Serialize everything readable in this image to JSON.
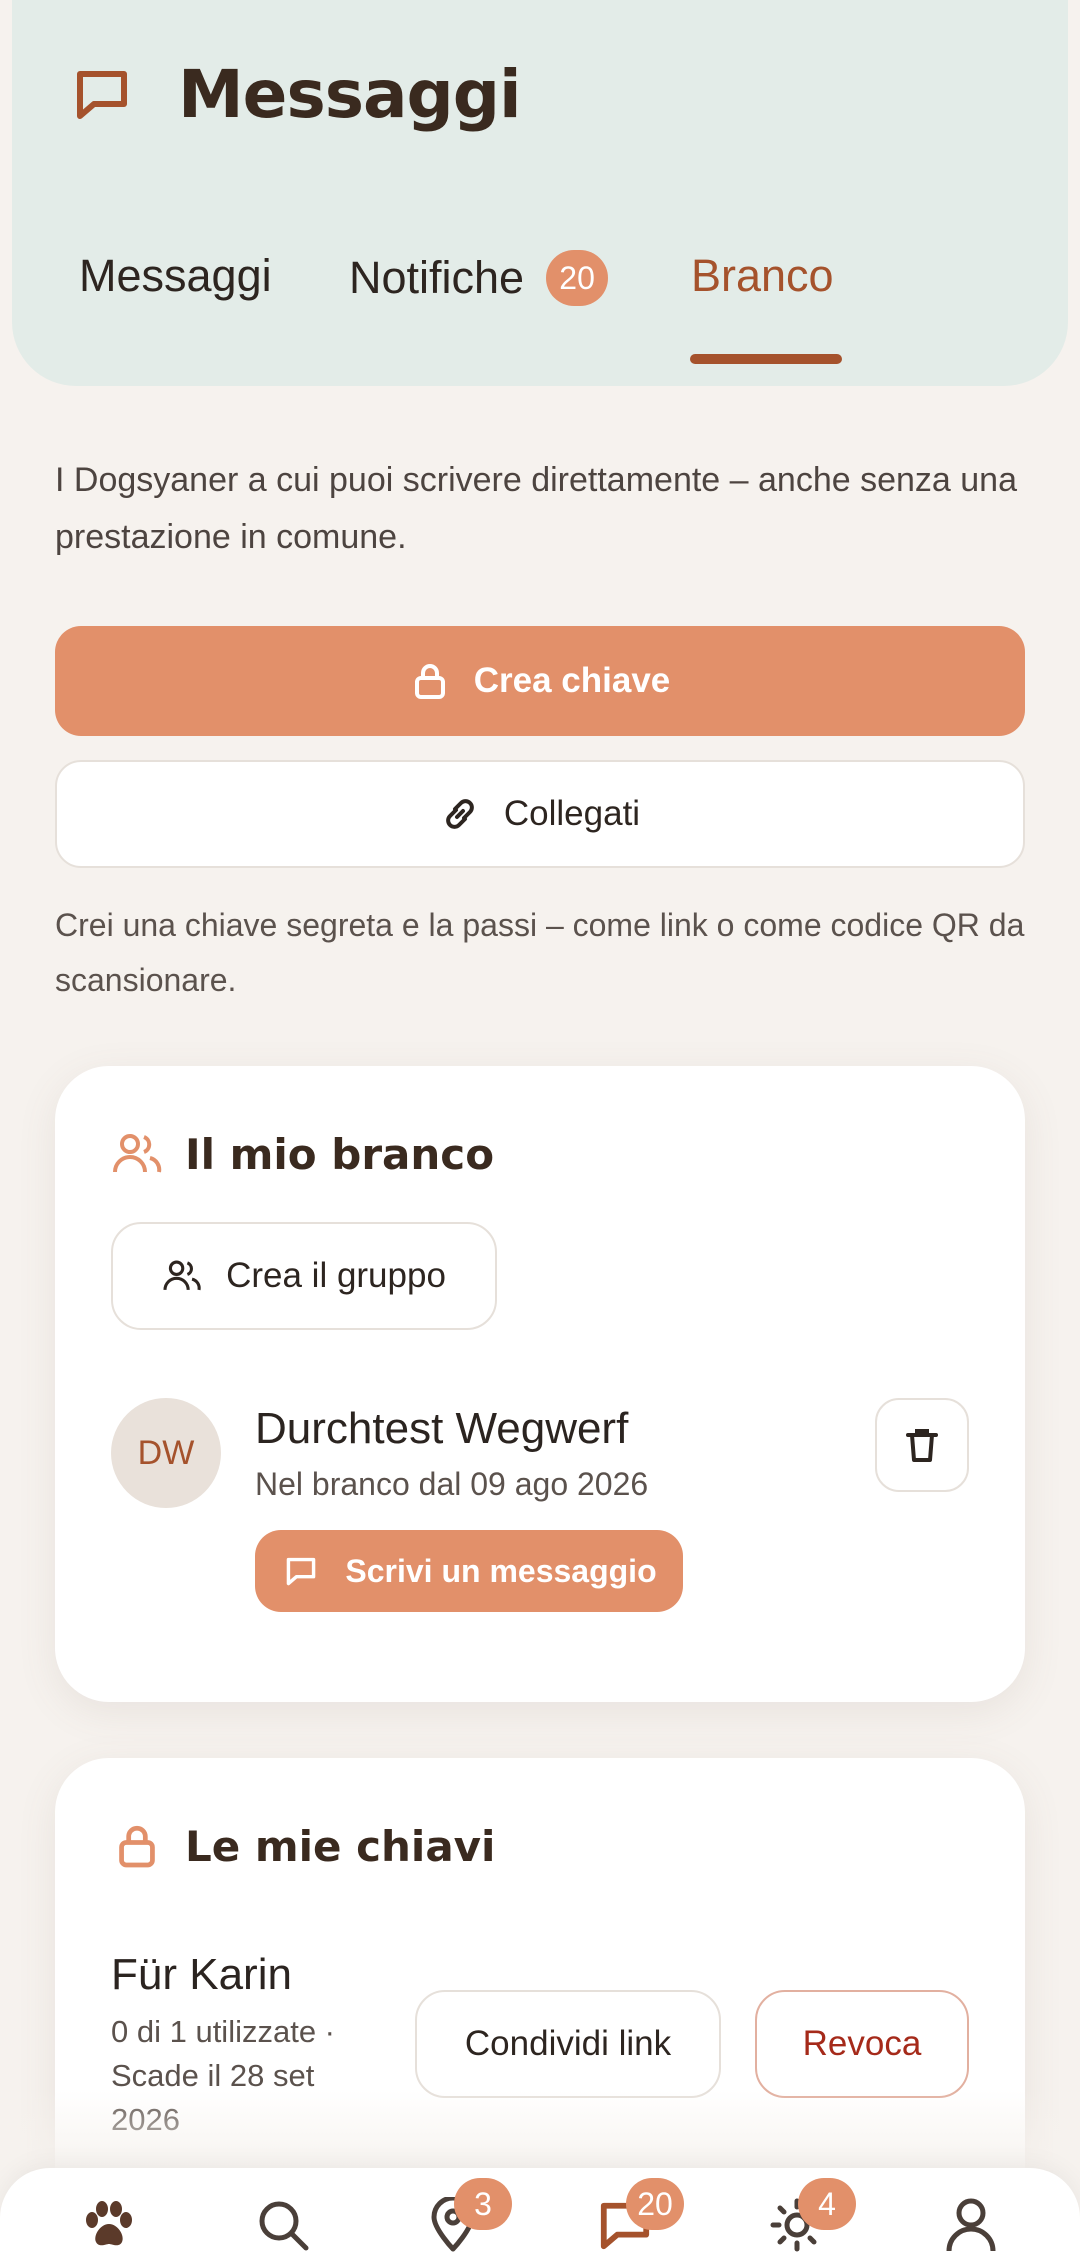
{
  "header": {
    "title": "Messaggi",
    "tabs": [
      {
        "label": "Messaggi"
      },
      {
        "label": "Notifiche",
        "badge": "20"
      },
      {
        "label": "Branco",
        "active": true
      }
    ]
  },
  "intro": "I Dogsyaner a cui puoi scrivere direttamente – anche senza una prestazione in comune.",
  "actions": {
    "create_key": "Crea chiave",
    "connect": "Collegati"
  },
  "hint": "Crei una chiave segreta e la passi – come link o come codice QR da scansionare.",
  "pack": {
    "title": "Il mio branco",
    "create_group": "Crea il gruppo",
    "members": [
      {
        "initials": "DW",
        "name": "Durchtest Wegwerf",
        "since": "Nel branco dal 09 ago 2026",
        "write_label": "Scrivi un messaggio"
      }
    ]
  },
  "keys": {
    "title": "Le mie chiavi",
    "items": [
      {
        "name": "Für Karin",
        "meta": "0 di 1 utilizzate · Scade il 28 set 2026",
        "share_label": "Condividi link",
        "revoke_label": "Revoca"
      }
    ]
  },
  "bottom_nav": [
    {
      "icon": "paw-icon"
    },
    {
      "icon": "search-icon"
    },
    {
      "icon": "location-pin-icon",
      "badge": "3"
    },
    {
      "icon": "chat-icon",
      "badge": "20",
      "active": true
    },
    {
      "icon": "sun-icon",
      "badge": "4"
    },
    {
      "icon": "profile-icon"
    }
  ],
  "colors": {
    "accent": "#e2906a",
    "brand_brown": "#a5522c",
    "header_bg": "#e3ece8",
    "revoke_red": "#a52a1a"
  }
}
